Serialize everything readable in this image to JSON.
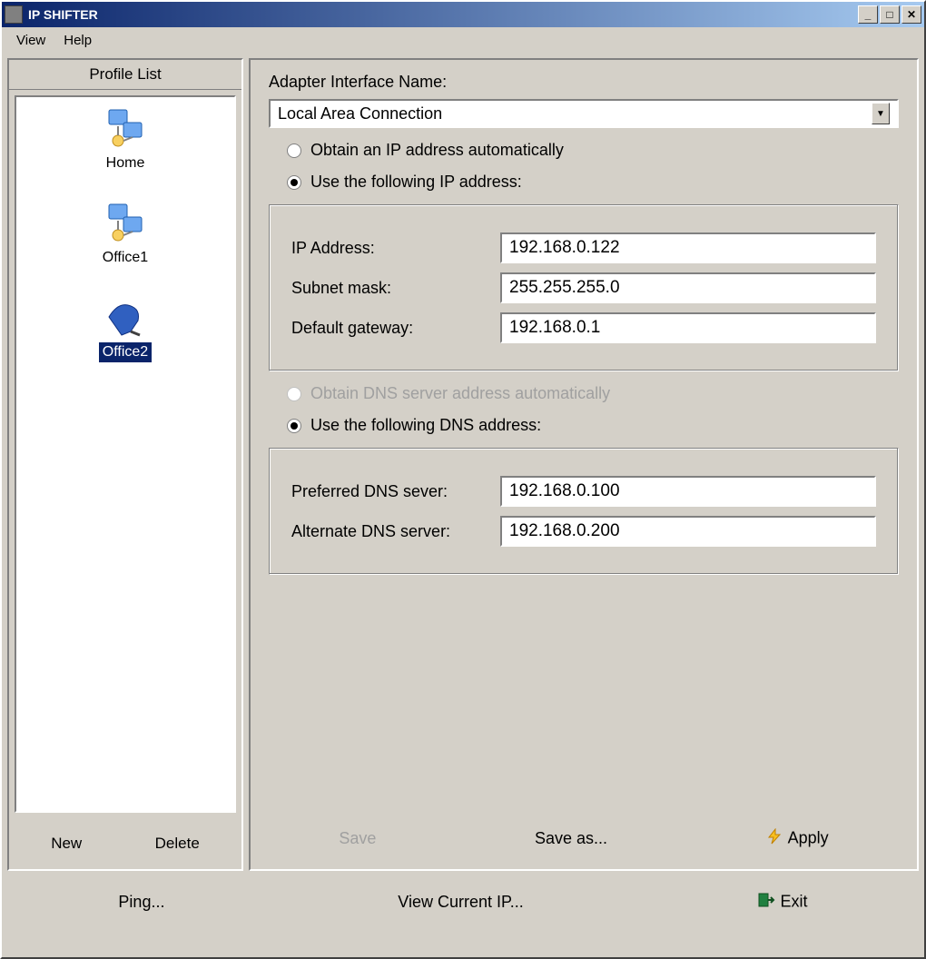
{
  "title": "IP SHIFTER",
  "menu": {
    "view": "View",
    "help": "Help"
  },
  "profileList": {
    "header": "Profile List",
    "items": [
      {
        "label": "Home",
        "selected": false
      },
      {
        "label": "Office1",
        "selected": false
      },
      {
        "label": "Office2",
        "selected": true
      }
    ],
    "newBtn": "New",
    "deleteBtn": "Delete"
  },
  "settings": {
    "adapterLabel": "Adapter Interface Name:",
    "adapterValue": "Local Area Connection",
    "ipAuto": "Obtain an IP address  automatically",
    "ipManual": "Use the following IP address:",
    "ipMode": "manual",
    "ipAddressLabel": "IP  Address:",
    "ipAddress": "192.168.0.122",
    "subnetLabel": "Subnet mask:",
    "subnet": "255.255.255.0",
    "gatewayLabel": "Default gateway:",
    "gateway": "192.168.0.1",
    "dnsAuto": "Obtain DNS server  address automatically",
    "dnsManual": "Use the following DNS address:",
    "dnsMode": "manual",
    "prefDnsLabel": "Preferred DNS sever:",
    "prefDns": "192.168.0.100",
    "altDnsLabel": "Alternate DNS server:",
    "altDns": "192.168.0.200"
  },
  "actions": {
    "save": "Save",
    "saveAs": "Save as...",
    "apply": "Apply"
  },
  "bottom": {
    "ping": "Ping...",
    "viewCurrent": "View Current IP...",
    "exit": "Exit"
  }
}
